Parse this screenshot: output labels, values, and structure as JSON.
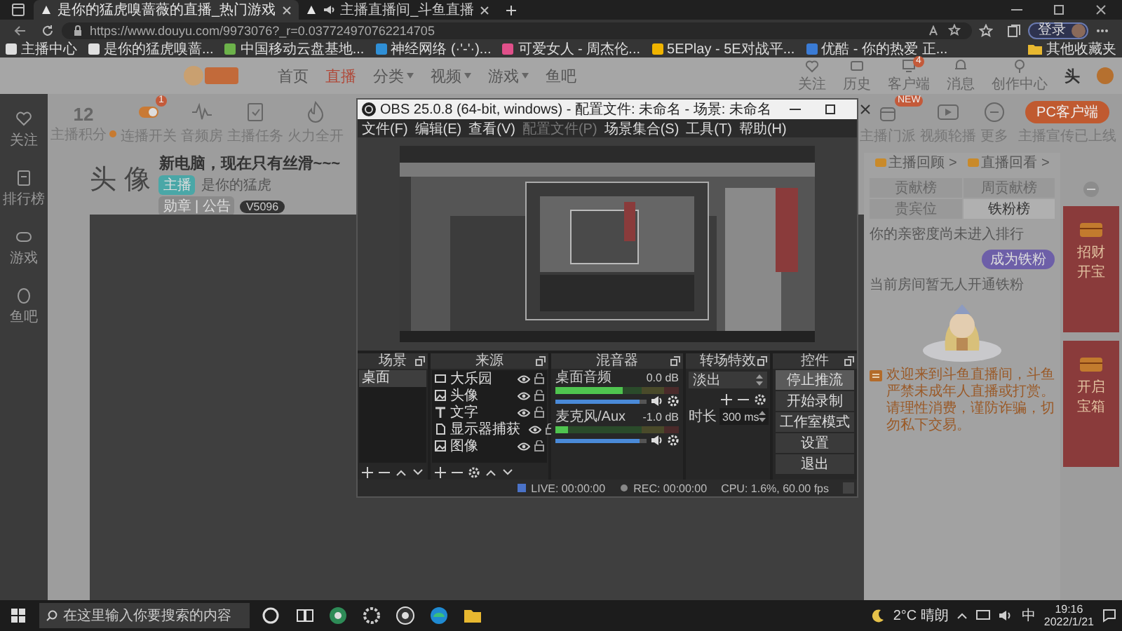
{
  "browser": {
    "tabs": [
      {
        "label": "是你的猛虎嗅蔷薇的直播_热门游戏",
        "selected": true,
        "audio": false
      },
      {
        "label": "主播直播间_斗鱼直播",
        "selected": false,
        "audio": true
      }
    ],
    "address": "https://www.douyu.com/9973076?_r=0.037724970762214705",
    "profile": "登录",
    "bookmarks": [
      "主播中心",
      "是你的猛虎嗅蔷...",
      "中国移动云盘基地...",
      "神经网络 (·'-'·)...",
      "可爱女人 - 周杰伦...",
      "5EPlay - 5E对战平...",
      "优酷 - 你的热爱 正..."
    ],
    "other_bookmarks": "其他收藏夹"
  },
  "page": {
    "sidebar": [
      {
        "label": "关注"
      },
      {
        "label": "排行榜"
      },
      {
        "label": "游戏"
      },
      {
        "label": "鱼吧"
      }
    ],
    "nav": [
      {
        "label": "首页",
        "selected": false,
        "dropdown": false
      },
      {
        "label": "直播",
        "selected": true,
        "dropdown": false
      },
      {
        "label": "分类",
        "selected": false,
        "dropdown": true
      },
      {
        "label": "视频",
        "selected": false,
        "dropdown": true
      },
      {
        "label": "游戏",
        "selected": false,
        "dropdown": true
      },
      {
        "label": "鱼吧",
        "selected": false,
        "dropdown": false
      }
    ],
    "user_menu": [
      {
        "label": "关注"
      },
      {
        "label": "历史"
      },
      {
        "label": "客户端",
        "badge": "4"
      },
      {
        "label": "消息"
      },
      {
        "label": "创作中心"
      }
    ],
    "user_name": "头",
    "stats": {
      "score": "12",
      "score_label": "主播积分",
      "tools_left": [
        {
          "label": "连播开关",
          "badge": "1"
        },
        {
          "label": "音频房"
        },
        {
          "label": "主播任务"
        },
        {
          "label": "火力全开"
        }
      ],
      "tools_right": [
        {
          "label": "主播门派",
          "badge": "NEW"
        },
        {
          "label": "视频轮播"
        },
        {
          "label": "更多"
        }
      ],
      "client_button": "PC客户端",
      "client_note": "主播宣传已上线"
    },
    "room": {
      "avatar": "头 像",
      "title": "新电脑，现在只有丝滑~~~",
      "tag": "主播",
      "owner": "是你的猛虎",
      "level": "V5096",
      "medal": "勋章 | 公告"
    },
    "panel": {
      "links": [
        "主播回顾 >",
        "直播回看 >"
      ],
      "tabs": [
        {
          "label": "贡献榜",
          "selected": false
        },
        {
          "label": "周贡献榜",
          "selected": false
        },
        {
          "label": "贵宾位",
          "selected": false
        },
        {
          "label": "铁粉榜",
          "selected": true
        }
      ],
      "intimacy": "你的亲密度尚未进入排行",
      "fan_button": "成为铁粉",
      "empty": "当前房间暂无人开通铁粉",
      "notice": "欢迎来到斗鱼直播间，斗鱼严禁未成年人直播或打赏。请理性消费，谨防诈骗，切勿私下交易。"
    },
    "ads": [
      {
        "title": "招财开宝"
      },
      {
        "title": "开启宝箱"
      }
    ]
  },
  "obs": {
    "title": "OBS 25.0.8 (64-bit, windows) - 配置文件: 未命名 - 场景: 未命名",
    "menu": [
      {
        "label": "文件(F)",
        "disabled": false
      },
      {
        "label": "编辑(E)",
        "disabled": false
      },
      {
        "label": "查看(V)",
        "disabled": false
      },
      {
        "label": "配置文件(P)",
        "disabled": true
      },
      {
        "label": "场景集合(S)",
        "disabled": false
      },
      {
        "label": "工具(T)",
        "disabled": false
      },
      {
        "label": "帮助(H)",
        "disabled": false
      }
    ],
    "scenes": {
      "title": "场景",
      "items": [
        {
          "label": "桌面",
          "selected": true
        }
      ]
    },
    "sources": {
      "title": "来源",
      "items": [
        {
          "label": "大乐园",
          "kind": "display",
          "visible": true,
          "locked": false
        },
        {
          "label": "头像",
          "kind": "image",
          "visible": true,
          "locked": false
        },
        {
          "label": "文字",
          "kind": "text",
          "visible": true,
          "locked": false
        },
        {
          "label": "显示器捕获",
          "kind": "window",
          "visible": true,
          "locked": false
        },
        {
          "label": "图像",
          "kind": "image",
          "visible": true,
          "locked": false
        }
      ]
    },
    "mixer": {
      "title": "混音器",
      "channels": [
        {
          "name": "桌面音频",
          "reading": "0.0 dB",
          "meter": {
            "level": 0.55
          },
          "volume": {
            "level": 0.92
          }
        },
        {
          "name": "麦克风/Aux",
          "reading": "-1.0 dB",
          "meter": {
            "level": 0.1
          },
          "volume": {
            "level": 0.92
          }
        }
      ]
    },
    "transitions": {
      "title": "转场特效",
      "value": "淡出",
      "duration_label": "时长",
      "duration": "300 ms"
    },
    "controls": {
      "title": "控件",
      "buttons": [
        {
          "label": "停止推流",
          "active": true
        },
        {
          "label": "开始录制",
          "active": false
        },
        {
          "label": "工作室模式",
          "active": false
        },
        {
          "label": "设置",
          "active": false
        },
        {
          "label": "退出",
          "active": false
        }
      ]
    },
    "status": {
      "live": "LIVE: 00:00:00",
      "rec": "REC: 00:00:00",
      "cpu": "CPU: 1.6%, 60.00 fps"
    }
  },
  "taskbar": {
    "search_placeholder": "在这里输入你要搜索的内容",
    "weather": "2°C 晴朗",
    "ime": "中",
    "time": "19:16",
    "date": "2022/1/21"
  }
}
